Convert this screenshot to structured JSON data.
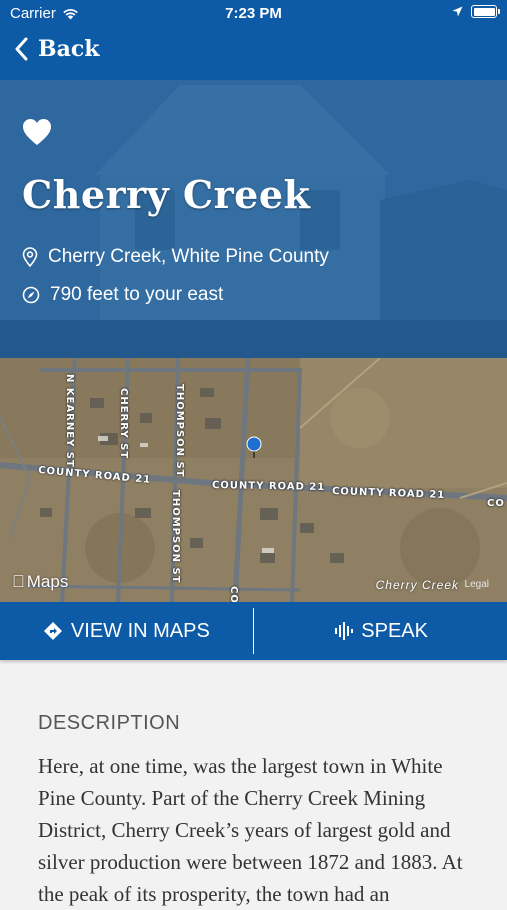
{
  "status": {
    "carrier": "Carrier",
    "time": "7:23 PM"
  },
  "nav": {
    "back_label": "Back"
  },
  "hero": {
    "title": "Cherry Creek",
    "location": "Cherry Creek, White Pine County",
    "distance": "790 feet to your east",
    "favorite_icon": "heart-icon"
  },
  "map": {
    "roads": {
      "county_road_left": "COUNTY ROAD 21",
      "county_road_mid": "COUNTY ROAD 21",
      "county_road_right": "COUNTY ROAD 21",
      "county_road_edge": "CO",
      "kearney": "N KEARNEY ST",
      "cherry": "CHERRY ST",
      "thompson_top": "THOMPSON ST",
      "thompson_bottom": "THOMPSON ST",
      "bottom_road": "CO"
    },
    "logo_text": "Maps",
    "place_label": "Cherry Creek",
    "legal": "Legal"
  },
  "actions": {
    "view_maps": "VIEW IN MAPS",
    "speak": "SPEAK"
  },
  "description": {
    "heading": "DESCRIPTION",
    "body": "Here, at one time, was the largest town in White Pine County. Part of the Cherry Creek Mining District, Cherry Creek’s years of largest gold and silver production were between 1872 and 1883. At the peak of its prosperity, the town had an"
  },
  "colors": {
    "primary": "#0d5aa6",
    "pin": "#1f6fd1",
    "background": "#f2f2f2"
  }
}
